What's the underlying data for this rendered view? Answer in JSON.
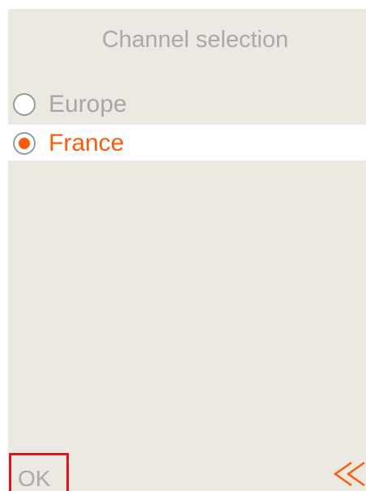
{
  "screen": {
    "title": "Channel selection",
    "options": [
      {
        "label": "Europe",
        "selected": false
      },
      {
        "label": "France",
        "selected": true
      }
    ],
    "footer": {
      "ok_label": "OK",
      "back_icon": "double-chevron-left-icon"
    }
  },
  "colors": {
    "background": "#ece9e2",
    "accent": "#ff5a0a",
    "muted_text": "#a9a9a9",
    "highlight": "#e0141e"
  }
}
